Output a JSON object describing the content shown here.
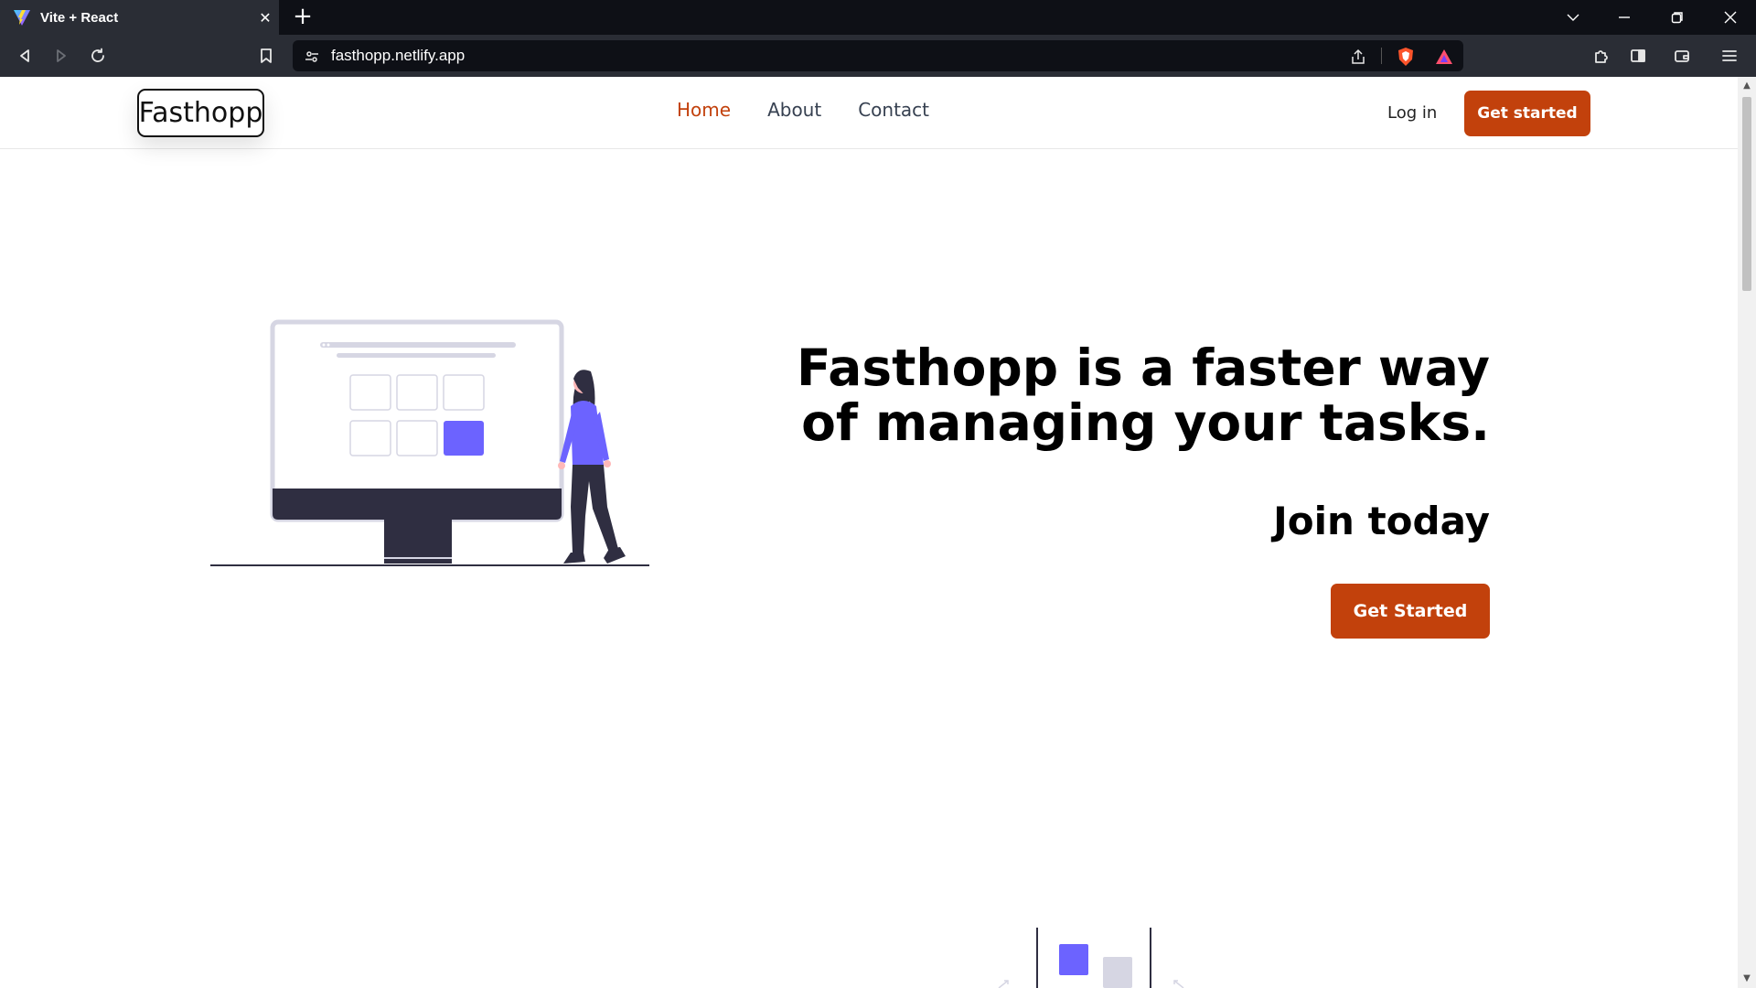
{
  "browser": {
    "tab_title": "Vite + React",
    "tab_close": "✕",
    "new_tab": "+",
    "url": "fasthopp.netlify.app"
  },
  "navbar": {
    "logo": "Fasthopp",
    "links": [
      {
        "label": "Home",
        "active": true
      },
      {
        "label": "About",
        "active": false
      },
      {
        "label": "Contact",
        "active": false
      }
    ],
    "login": "Log in",
    "cta": "Get started"
  },
  "hero": {
    "title": "Fasthopp is a faster way of managing your tasks.",
    "subtitle": "Join today",
    "cta": "Get Started"
  },
  "colors": {
    "accent": "#c2410c",
    "illustration_purple": "#6c63ff",
    "illustration_dark": "#2f2e41",
    "chrome_dark": "#0e1016",
    "chrome_toolbar": "#2a2d35"
  },
  "icons": {
    "tab_favicon": "vite-logo-icon",
    "back": "back-arrow-icon",
    "forward": "forward-arrow-icon",
    "reload": "reload-icon",
    "bookmark": "bookmark-icon",
    "site_settings": "site-settings-icon",
    "share": "share-icon",
    "brave_shield": "brave-shield-icon",
    "brave_rewards": "brave-rewards-icon",
    "extensions": "puzzle-icon",
    "sidebar": "sidebar-icon",
    "wallet": "wallet-icon",
    "menu": "hamburger-menu-icon"
  }
}
